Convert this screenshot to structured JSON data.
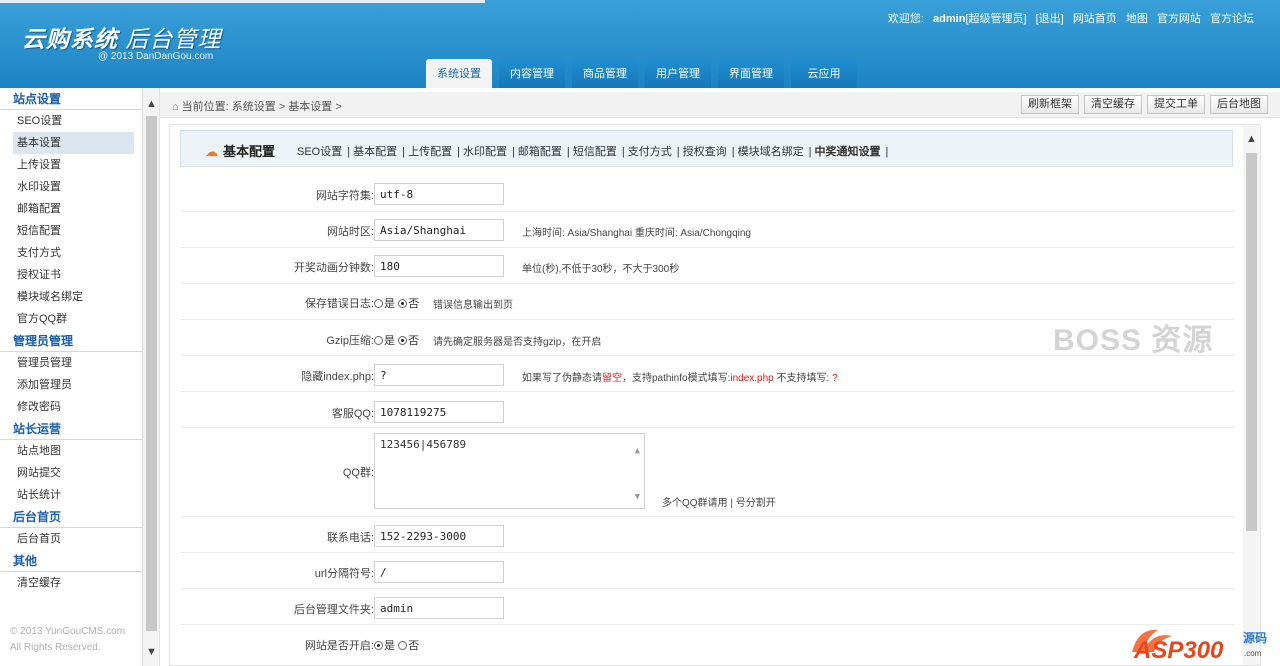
{
  "header": {
    "title_bold": "云购系统",
    "title_thin": "后台管理",
    "subtitle": "@ 2013  DanDanGou.com",
    "welcome": "欢迎您:",
    "user": "admin",
    "role": "[超级管理员]",
    "logout": "[退出]",
    "links": [
      "网站首页",
      "地图",
      "官方网站",
      "官方论坛"
    ],
    "tabs": [
      "系统设置",
      "内容管理",
      "商品管理",
      "用户管理",
      "界面管理",
      "云应用"
    ],
    "active_tab": 0
  },
  "sidebar": {
    "groups": [
      {
        "title": "站点设置",
        "items": [
          "SEO设置",
          "基本设置",
          "上传设置",
          "水印设置",
          "邮箱配置",
          "短信配置",
          "支付方式",
          "授权证书",
          "模块域名绑定",
          "官方QQ群"
        ]
      },
      {
        "title": "管理员管理",
        "items": [
          "管理员管理",
          "添加管理员",
          "修改密码"
        ]
      },
      {
        "title": "站长运营",
        "items": [
          "站点地图",
          "网站提交",
          "站长统计"
        ]
      },
      {
        "title": "后台首页",
        "items": [
          "后台首页"
        ]
      },
      {
        "title": "其他",
        "items": [
          "清空缓存"
        ]
      }
    ],
    "active_item": "基本设置",
    "footer_line1": "© 2013 YunGouCMS.com",
    "footer_line2": "All Rights Reserved."
  },
  "breadcrumb": {
    "text": "当前位置: 系统设置 > 基本设置 >",
    "buttons": [
      "刷新框架",
      "清空缓存",
      "提交工单",
      "后台地图"
    ]
  },
  "config": {
    "title": "基本配置",
    "links": [
      "SEO设置",
      "基本配置",
      "上传配置",
      "水印配置",
      "邮箱配置",
      "短信配置",
      "支付方式",
      "授权查询",
      "模块域名绑定",
      "中奖通知设置"
    ]
  },
  "form": {
    "charset_label": "网站字符集:",
    "charset_value": "utf-8",
    "timezone_label": "网站时区:",
    "timezone_value": "Asia/Shanghai",
    "timezone_hint": "上海时间: Asia/Shanghai 重庆时间: Asia/Chongqing",
    "anim_label": "开奖动画分钟数:",
    "anim_value": "180",
    "anim_hint": "单位(秒),不低于30秒，不大于300秒",
    "errlog_label": "保存错误日志:",
    "yes": "是",
    "no": "否",
    "errlog_hint": "错误信息输出到页",
    "gzip_label": "Gzip压缩:",
    "gzip_hint": "请先确定服务器是否支持gzip，在开启",
    "hide_label": "隐藏index.php:",
    "hide_value": "?",
    "hide_hint_a": "如果写了伪静态请",
    "hide_hint_red1": "留空",
    "hide_hint_b": "，支持pathinfo模式填写:",
    "hide_hint_red2": "index.php",
    "hide_hint_c": " 不支持填写:",
    "hide_hint_red3": " ?",
    "qq_label": "客服QQ:",
    "qq_value": "1078119275",
    "qqgroup_label": "QQ群:",
    "qqgroup_value": "123456|456789",
    "qqgroup_hint": "多个QQ群请用 | 号分割开",
    "phone_label": "联系电话:",
    "phone_value": "152-2293-3000",
    "urlsep_label": "url分隔符号:",
    "urlsep_value": "/",
    "admindir_label": "后台管理文件夹:",
    "admindir_value": "admin",
    "open_label": "网站是否开启:"
  },
  "watermark": "BOSS 资源",
  "stamp": "ASP300源码",
  "colors": {
    "header_blue": "#1c84c4",
    "sidebar_group": "#1d5fa8",
    "accent_orange": "#f07a2a",
    "hint_red": "#e02020"
  }
}
